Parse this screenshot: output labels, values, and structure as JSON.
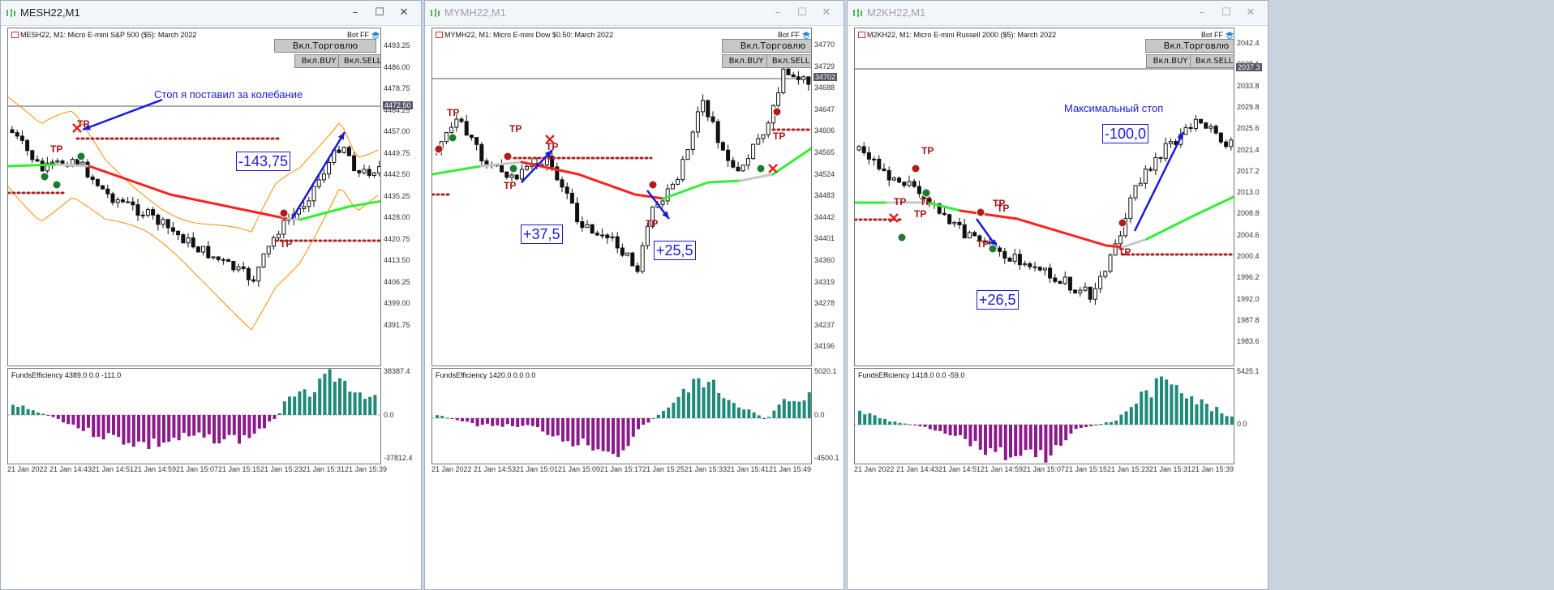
{
  "windows": [
    {
      "title": "MESH22,M1",
      "active": true,
      "symbol_line": "MESH22, M1:  Micro E-mini S&P 500 ($5): March 2022",
      "bot_label": "Bot FF",
      "trade_button": "Вкл.Торговлю",
      "buy_button": "Вкл.BUY",
      "sell_button": "Вкл.SELL",
      "price_labels": [
        "4493.25",
        "4486.00",
        "4478.75",
        "4464.25",
        "4457.00",
        "4449.75",
        "4442.50",
        "4435.25",
        "4428.00",
        "4420.75",
        "4413.50",
        "4406.25",
        "4399.00",
        "4391.75"
      ],
      "price_tag": "4472.50",
      "indicator_title": "FundsEfficiency 4389.0 0.0 -111.0",
      "indicator_labels": [
        "38387.4",
        "0.0",
        "-37812.4"
      ],
      "time_labels": [
        "21 Jan 2022",
        "21 Jan 14:43",
        "21 Jan 14:51",
        "21 Jan 14:59",
        "21 Jan 15:07",
        "21 Jan 15:15",
        "21 Jan 15:23",
        "21 Jan 15:31",
        "21 Jan 15:39"
      ],
      "annotation_box": "-143,75",
      "annotation_text": "Стоп я поставил за колебание"
    },
    {
      "title": "MYMH22,M1",
      "active": false,
      "symbol_line": "MYMH22, M1:  Micro E-mini Dow $0.50: March 2022",
      "bot_label": "Bot FF",
      "trade_button": "Вкл.Торговлю",
      "buy_button": "Вкл.BUY",
      "sell_button": "Вкл.SELL",
      "price_labels": [
        "34770",
        "34729",
        "34688",
        "34647",
        "34606",
        "34565",
        "34524",
        "34483",
        "34442",
        "34401",
        "34360",
        "34319",
        "34278",
        "34237",
        "34196"
      ],
      "price_tag": "34702",
      "indicator_title": "FundsEfficiency 1420.0 0.0 0.0",
      "indicator_labels": [
        "5020.1",
        "0.0",
        "-4500.1"
      ],
      "time_labels": [
        "21 Jan 2022",
        "21 Jan 14:53",
        "21 Jan 15:01",
        "21 Jan 15:09",
        "21 Jan 15:17",
        "21 Jan 15:25",
        "21 Jan 15:33",
        "21 Jan 15:41",
        "21 Jan 15:49"
      ],
      "annotation_box_1": "+37,5",
      "annotation_box_2": "+25,5"
    },
    {
      "title": "M2KH22,M1",
      "active": false,
      "symbol_line": "M2KH22, M1:  Micro E-mini Russell 2000 ($5): March 2022",
      "bot_label": "Bot FF",
      "trade_button": "Вкл.Торговлю",
      "buy_button": "Вкл.BUY",
      "sell_button": "Вкл.SELL",
      "price_labels": [
        "2042.4",
        "2038.1",
        "2033.8",
        "2029.8",
        "2025.6",
        "2021.4",
        "2017.2",
        "2013.0",
        "2008.8",
        "2004.6",
        "2000.4",
        "1996.2",
        "1992.0",
        "1987.8",
        "1983.6"
      ],
      "price_tag": "2037.3",
      "indicator_title": "FundsEfficiency 1418.0 0.0 -59.0",
      "indicator_labels": [
        "5425.1",
        "0.0"
      ],
      "time_labels": [
        "21 Jan 2022",
        "21 Jan 14:43",
        "21 Jan 14:51",
        "21 Jan 14:59",
        "21 Jan 15:07",
        "21 Jan 15:15",
        "21 Jan 15:23",
        "21 Jan 15:31",
        "21 Jan 15:39"
      ],
      "annotation_box": "-100,0",
      "annotation_text": "Максимальный стоп"
    }
  ],
  "tp_label": "TP",
  "colors": {
    "ma_down": "#ff2020",
    "ma_up": "#33ee33",
    "ma_flat": "#c8c8c8",
    "bollinger": "#ff8c00",
    "level_dots": "#b22222",
    "histogram_up": "#1f8a7a",
    "histogram_down": "#8b1a8b",
    "annotation": "#1b1bd6"
  }
}
